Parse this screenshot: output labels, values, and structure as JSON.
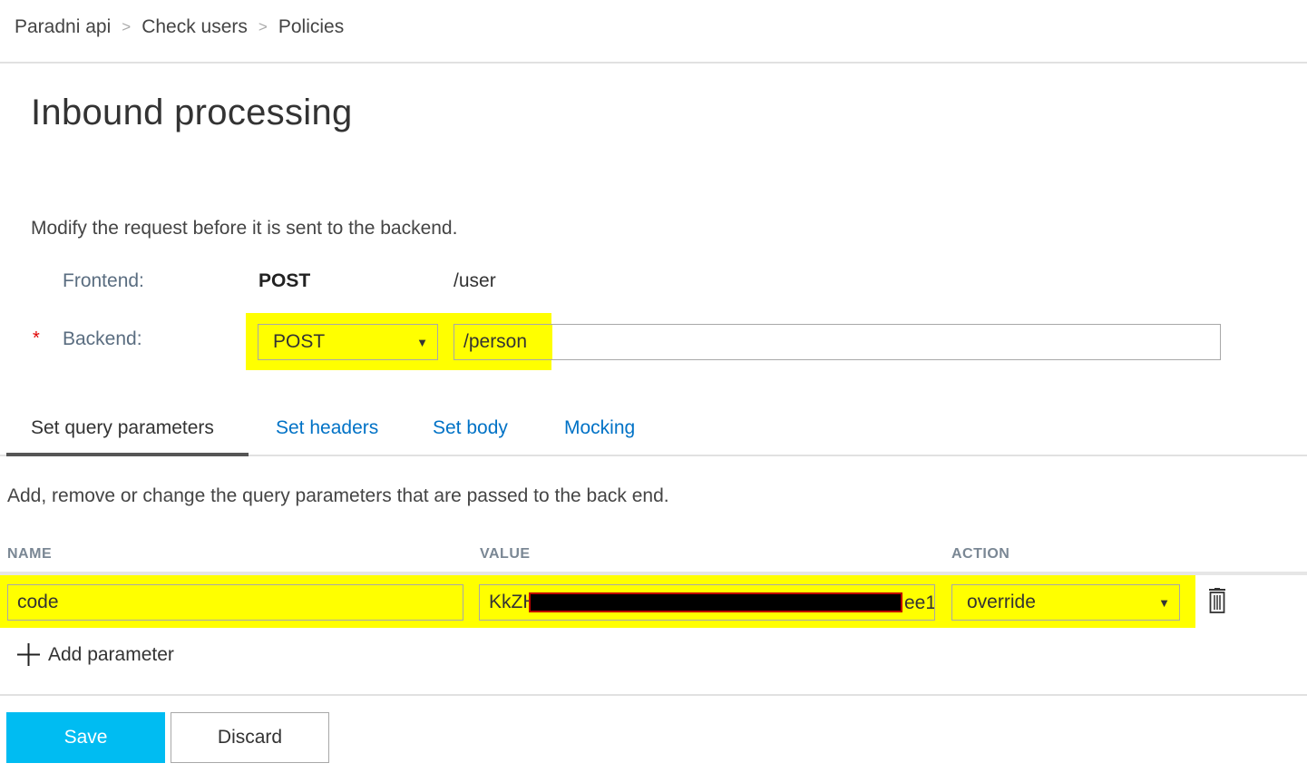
{
  "breadcrumb": [
    "Paradni api",
    "Check users",
    "Policies"
  ],
  "breadcrumb_separator": ">",
  "page_title": "Inbound processing",
  "description": "Modify the request before it is sent to the backend.",
  "frontend": {
    "label": "Frontend:",
    "method": "POST",
    "path": "/user"
  },
  "backend": {
    "required_marker": "*",
    "label": "Backend:",
    "method": "POST",
    "path": "/person"
  },
  "tabs": [
    {
      "label": "Set query parameters",
      "active": true
    },
    {
      "label": "Set headers",
      "active": false
    },
    {
      "label": "Set body",
      "active": false
    },
    {
      "label": "Mocking",
      "active": false
    }
  ],
  "tab_description": "Add, remove or change the query parameters that are passed to the back end.",
  "columns": {
    "name": "NAME",
    "value": "VALUE",
    "action": "ACTION"
  },
  "parameters": [
    {
      "name": "code",
      "value_prefix": "KkZH",
      "value_suffix": "ee1",
      "action": "override"
    }
  ],
  "add_parameter_label": "Add parameter",
  "buttons": {
    "save": "Save",
    "discard": "Discard"
  },
  "colors": {
    "highlight": "#ffff00",
    "accent": "#00bcf2",
    "link": "#0072c6",
    "redaction": "#000000"
  },
  "icons": {
    "dropdown": "triangle-down",
    "delete": "trash",
    "add": "plus"
  }
}
